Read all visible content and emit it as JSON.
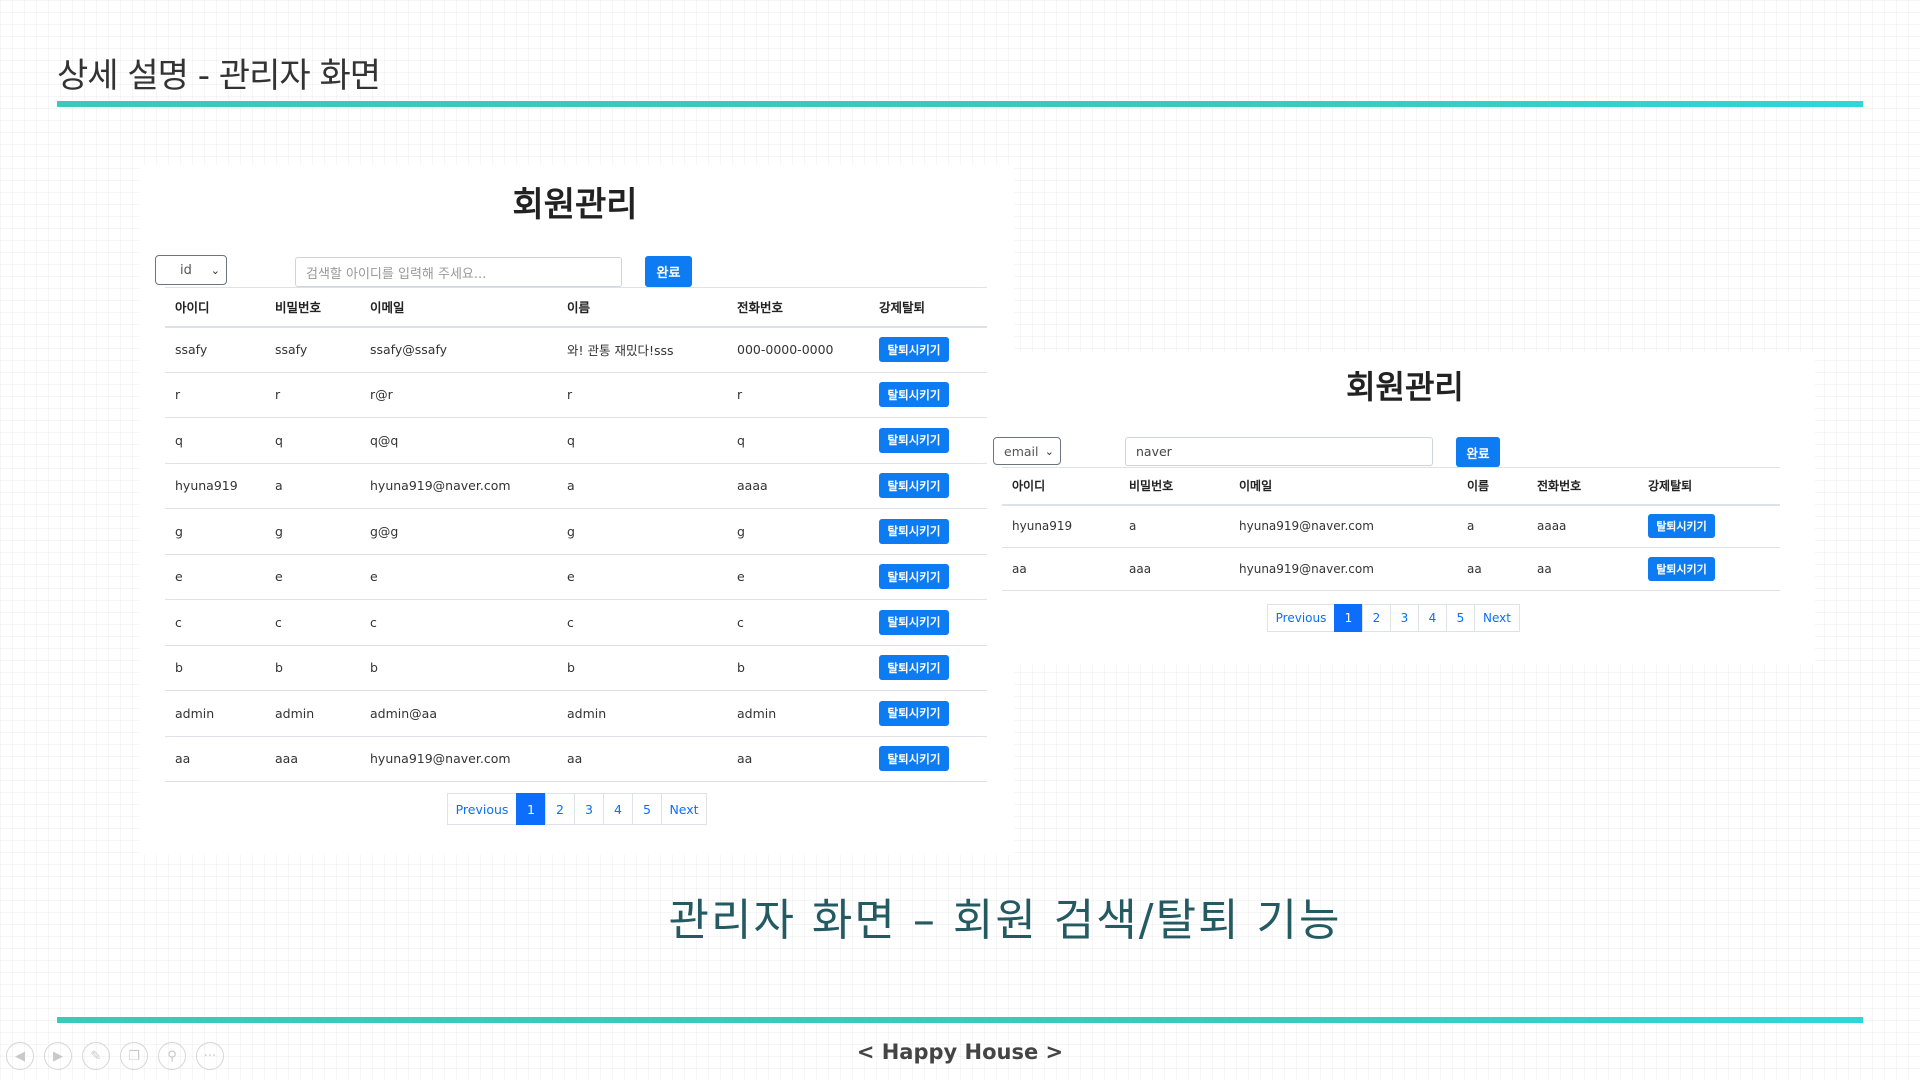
{
  "slide": {
    "title": "상세 설명 - 관리자 화면",
    "caption": "관리자 화면 – 회원 검색/탈퇴 기능",
    "footer": "< Happy House >"
  },
  "panel1": {
    "title": "회원관리",
    "search_type": "id",
    "search_placeholder": "검색할 아이디를 입력해 주세요...",
    "search_value": "",
    "submit_label": "완료",
    "headers": [
      "아이디",
      "비밀번호",
      "이메일",
      "이름",
      "전화번호",
      "강제탈퇴"
    ],
    "rows": [
      [
        "ssafy",
        "ssafy",
        "ssafy@ssafy",
        "와! 관통 재밌다!sss",
        "000-0000-0000"
      ],
      [
        "r",
        "r",
        "r@r",
        "r",
        "r"
      ],
      [
        "q",
        "q",
        "q@q",
        "q",
        "q"
      ],
      [
        "hyuna919",
        "a",
        "hyuna919@naver.com",
        "a",
        "aaaa"
      ],
      [
        "g",
        "g",
        "g@g",
        "g",
        "g"
      ],
      [
        "e",
        "e",
        "e",
        "e",
        "e"
      ],
      [
        "c",
        "c",
        "c",
        "c",
        "c"
      ],
      [
        "b",
        "b",
        "b",
        "b",
        "b"
      ],
      [
        "admin",
        "admin",
        "admin@aa",
        "admin",
        "admin"
      ],
      [
        "aa",
        "aaa",
        "hyuna919@naver.com",
        "aa",
        "aa"
      ]
    ],
    "kick_label": "탈퇴시키기",
    "pagination": [
      "Previous",
      "1",
      "2",
      "3",
      "4",
      "5",
      "Next"
    ],
    "active_page": "1"
  },
  "panel2": {
    "title": "회원관리",
    "search_type": "email",
    "search_value": "naver",
    "submit_label": "완료",
    "headers": [
      "아이디",
      "비밀번호",
      "이메일",
      "이름",
      "전화번호",
      "강제탈퇴"
    ],
    "rows": [
      [
        "hyuna919",
        "a",
        "hyuna919@naver.com",
        "a",
        "aaaa"
      ],
      [
        "aa",
        "aaa",
        "hyuna919@naver.com",
        "aa",
        "aa"
      ]
    ],
    "kick_label": "탈퇴시키기",
    "pagination": [
      "Previous",
      "1",
      "2",
      "3",
      "4",
      "5",
      "Next"
    ],
    "active_page": "1"
  },
  "toolbar": {
    "icons": [
      "prev-slide-icon",
      "next-slide-icon",
      "pen-icon",
      "slides-overview-icon",
      "zoom-icon",
      "more-icon"
    ],
    "more_label": "···"
  },
  "colors": {
    "accent_rule": "#3cc9b9",
    "primary_button": "#0d7cf2",
    "caption_text": "#245a62"
  }
}
